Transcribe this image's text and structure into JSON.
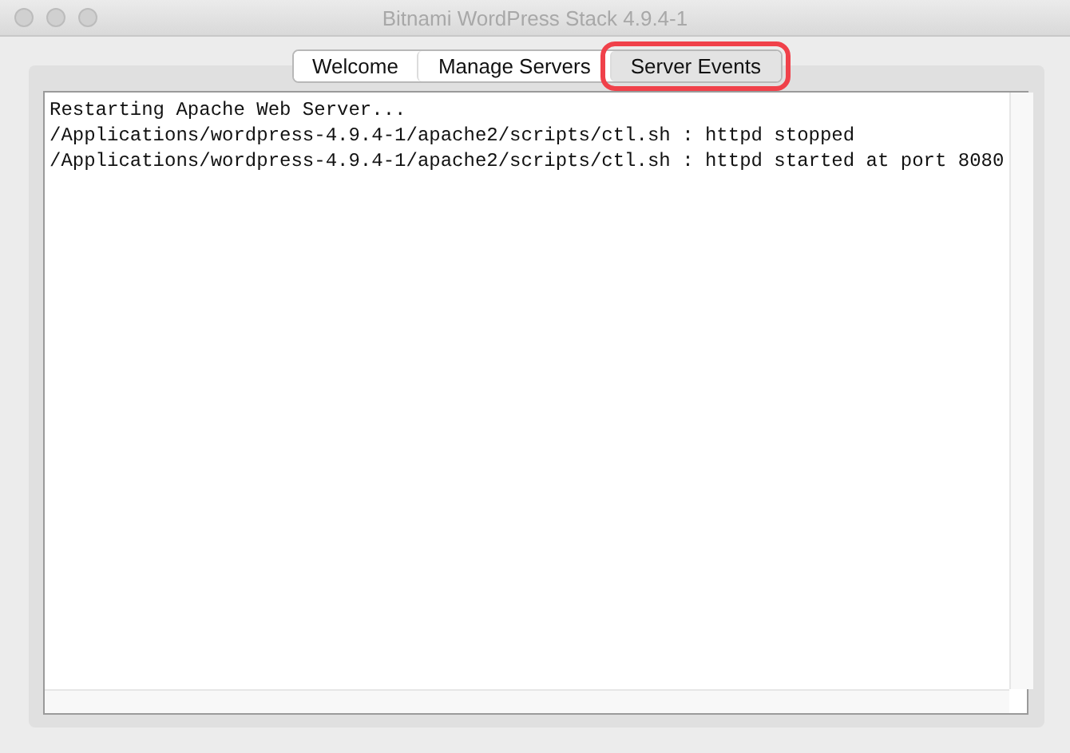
{
  "window": {
    "title": "Bitnami WordPress Stack 4.9.4-1"
  },
  "tabs": [
    {
      "label": "Welcome",
      "selected": false,
      "highlighted": false
    },
    {
      "label": "Manage Servers",
      "selected": false,
      "highlighted": false
    },
    {
      "label": "Server Events",
      "selected": true,
      "highlighted": true
    }
  ],
  "log": {
    "lines": [
      "Restarting Apache Web Server...",
      "/Applications/wordpress-4.9.4-1/apache2/scripts/ctl.sh : httpd stopped",
      "/Applications/wordpress-4.9.4-1/apache2/scripts/ctl.sh : httpd started at port 8080"
    ]
  }
}
